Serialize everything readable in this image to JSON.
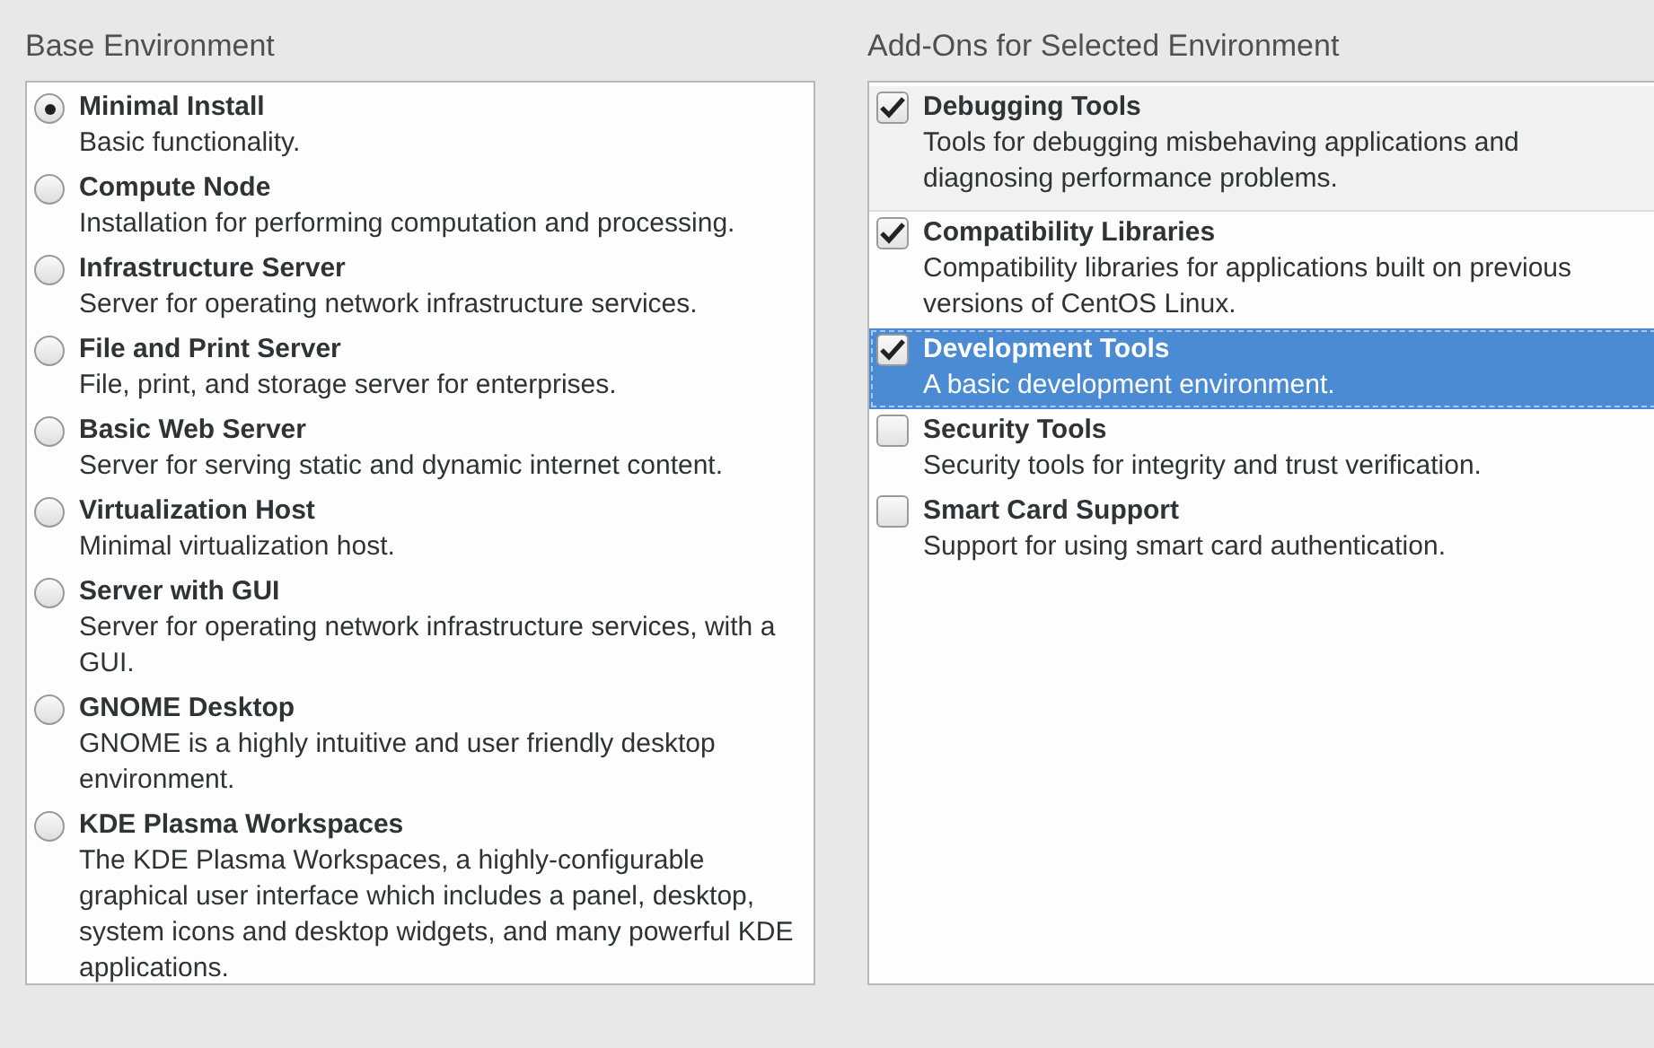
{
  "base_environment": {
    "title": "Base Environment",
    "items": [
      {
        "name": "Minimal Install",
        "description": "Basic functionality.",
        "selected": true
      },
      {
        "name": "Compute Node",
        "description": "Installation for performing computation and processing.",
        "selected": false
      },
      {
        "name": "Infrastructure Server",
        "description": "Server for operating network infrastructure services.",
        "selected": false
      },
      {
        "name": "File and Print Server",
        "description": "File, print, and storage server for enterprises.",
        "selected": false
      },
      {
        "name": "Basic Web Server",
        "description": "Server for serving static and dynamic internet content.",
        "selected": false
      },
      {
        "name": "Virtualization Host",
        "description": "Minimal virtualization host.",
        "selected": false
      },
      {
        "name": "Server with GUI",
        "description": "Server for operating network infrastructure services, with a GUI.",
        "selected": false
      },
      {
        "name": "GNOME Desktop",
        "description": "GNOME is a highly intuitive and user friendly desktop environment.",
        "selected": false
      },
      {
        "name": "KDE Plasma Workspaces",
        "description": "The KDE Plasma Workspaces, a highly-configurable graphical user interface which includes a panel, desktop, system icons and desktop widgets, and many powerful KDE applications.",
        "selected": false
      }
    ]
  },
  "addons": {
    "title": "Add-Ons for Selected Environment",
    "items": [
      {
        "name": "Debugging Tools",
        "description": "Tools for debugging misbehaving applications and diagnosing performance problems.",
        "checked": true,
        "selected": false,
        "hovered": true
      },
      {
        "name": "Compatibility Libraries",
        "description": "Compatibility libraries for applications built on previous versions of CentOS Linux.",
        "checked": true,
        "selected": false,
        "hovered": false
      },
      {
        "name": "Development Tools",
        "description": "A basic development environment.",
        "checked": true,
        "selected": true,
        "hovered": false
      },
      {
        "name": "Security Tools",
        "description": "Security tools for integrity and trust verification.",
        "checked": false,
        "selected": false,
        "hovered": false
      },
      {
        "name": "Smart Card Support",
        "description": "Support for using smart card authentication.",
        "checked": false,
        "selected": false,
        "hovered": false
      }
    ]
  }
}
